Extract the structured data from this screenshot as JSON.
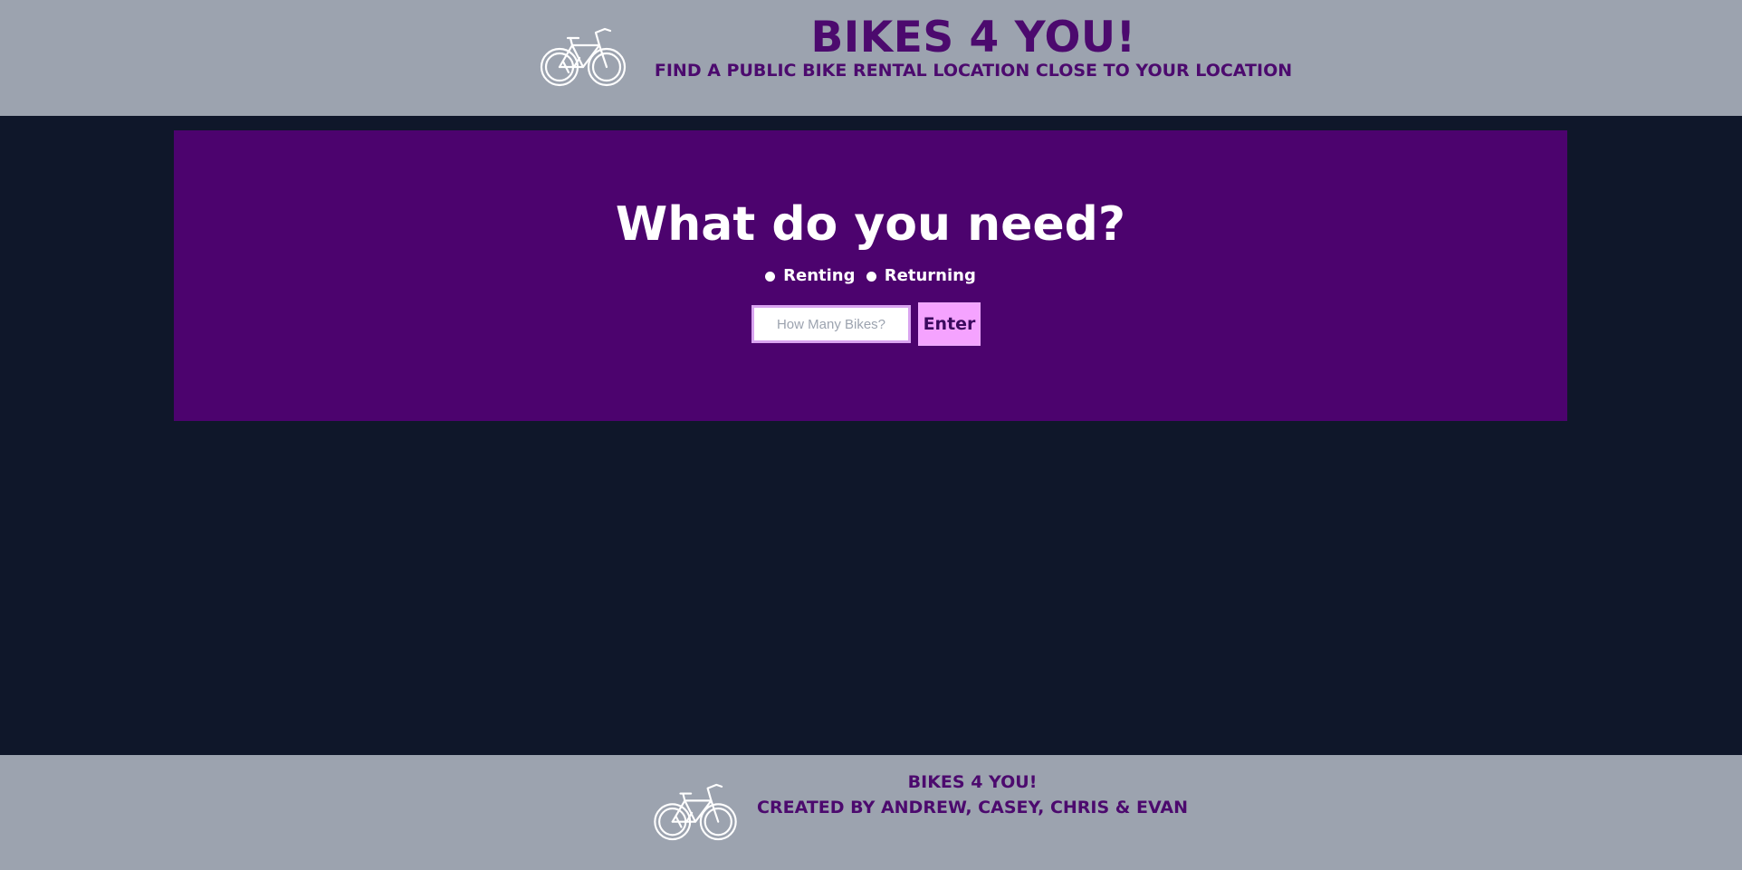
{
  "header": {
    "title": "BIKES 4 YOU!",
    "subtitle": "FIND A PUBLIC BIKE RENTAL LOCATION CLOSE TO YOUR LOCATION",
    "logo_icon": "bicycle-icon"
  },
  "main": {
    "question": "What do you need?",
    "options": [
      {
        "label": "Renting",
        "selected": false
      },
      {
        "label": "Returning",
        "selected": false
      }
    ],
    "bikes_input": {
      "value": "",
      "placeholder": "How Many Bikes?"
    },
    "enter_label": "Enter"
  },
  "footer": {
    "title": "BIKES 4 YOU!",
    "credits": "CREATED BY ANDREW, CASEY, CHRIS & EVAN",
    "logo_icon": "bicycle-icon"
  },
  "colors": {
    "background": "#0f172a",
    "header_footer_bg": "#9ca3af",
    "brand_purple": "#4c036e",
    "heading_text": "#4c0a6e",
    "button_pink": "#f5a3ff"
  }
}
